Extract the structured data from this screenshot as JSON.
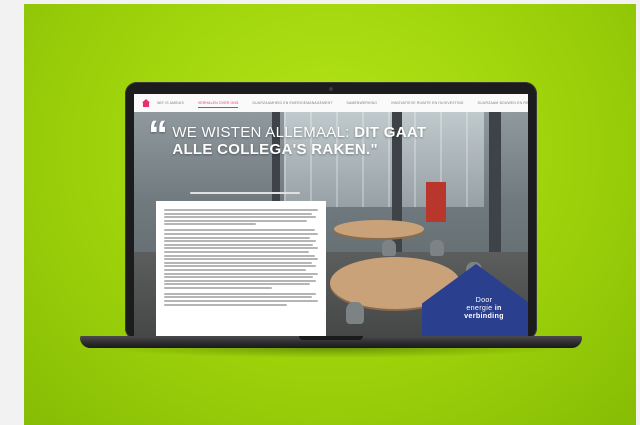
{
  "nav": {
    "home_icon": "home-icon",
    "tabs": [
      {
        "label": "Wie is Ambius"
      },
      {
        "label": "Verhalen over ons"
      },
      {
        "label": "Duurzaamheid en Energiemanagement"
      },
      {
        "label": "Samenwerking"
      },
      {
        "label": "Innovatieve ruimte en Huisvesting"
      },
      {
        "label": "Duurzaam bouwen en renoveren"
      }
    ],
    "active_tab_index": 1,
    "prev_icon": "chevron-left-icon",
    "next_icon": "chevron-right-icon"
  },
  "hero": {
    "quote_mark": "“",
    "headline_part1": "We wisten allemaal: ",
    "headline_bold1": "dit gaat",
    "headline_bold2": "alle collega's raken.\""
  },
  "badge": {
    "line1": "Door",
    "line2": "energie ",
    "line2_bold": "in",
    "line3_bold": "verbinding"
  },
  "colors": {
    "accent_pink": "#e8306f",
    "accent_navy": "#2b3f8f",
    "background_green": "#9dd20a"
  }
}
